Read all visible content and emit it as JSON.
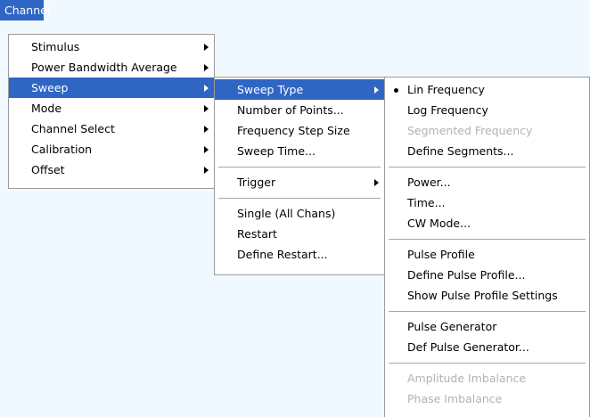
{
  "menubar": {
    "channel_label": "Channel"
  },
  "channel_menu": {
    "items": [
      "Stimulus",
      "Power Bandwidth Average",
      "Sweep",
      "Mode",
      "Channel Select",
      "Calibration",
      "Offset"
    ]
  },
  "sweep_menu": {
    "items": [
      "Sweep Type",
      "Number of Points...",
      "Frequency Step Size",
      "Sweep Time...",
      "Trigger",
      "Single (All Chans)",
      "Restart",
      "Define Restart..."
    ]
  },
  "sweep_type_menu": {
    "items": [
      "Lin Frequency",
      "Log Frequency",
      "Segmented Frequency",
      "Define Segments...",
      "Power...",
      "Time...",
      "CW Mode...",
      "Pulse Profile",
      "Define Pulse Profile...",
      "Show Pulse Profile Settings",
      "Pulse Generator",
      "Def Pulse Generator...",
      "Amplitude Imbalance",
      "Phase Imbalance"
    ],
    "selected": "Lin Frequency"
  },
  "colors": {
    "highlight": "#2f66c4",
    "background": "#f0f9ff",
    "disabled_text": "#b2b2b2"
  }
}
